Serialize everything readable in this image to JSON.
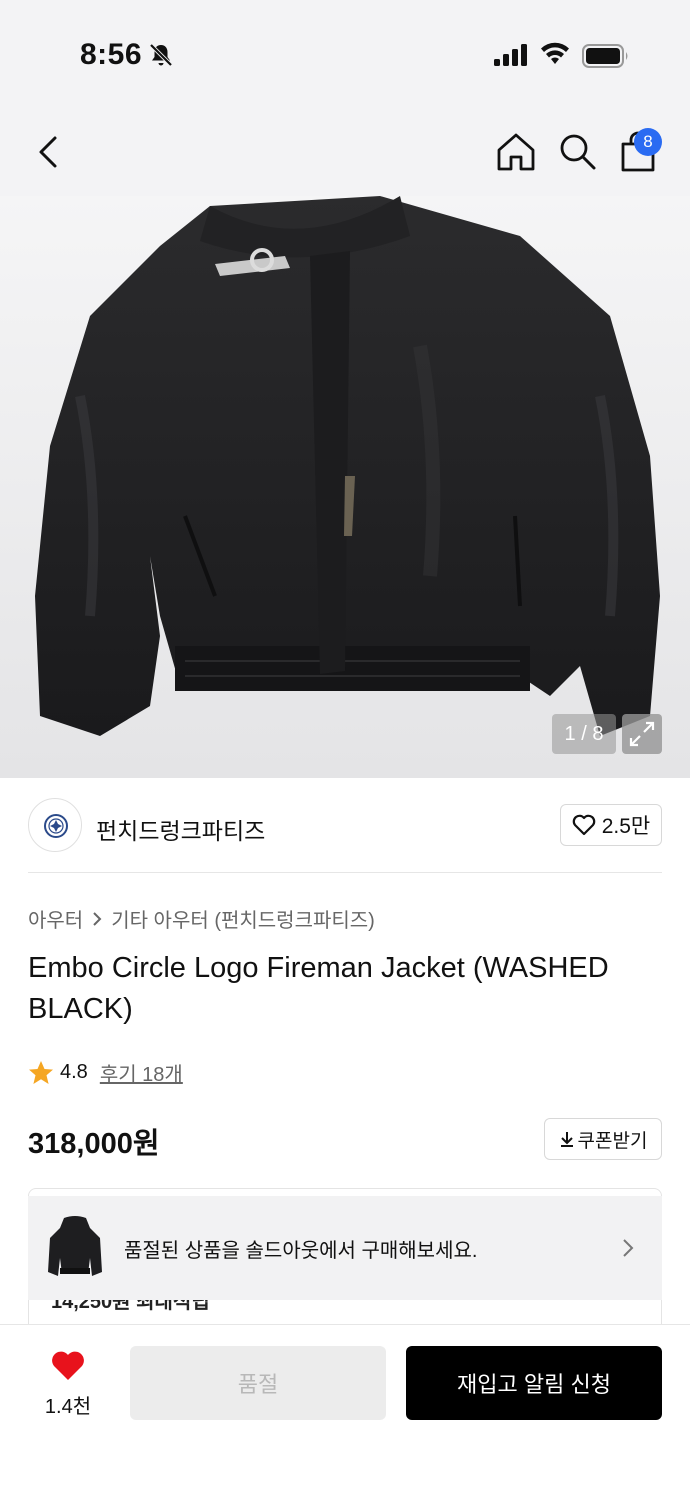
{
  "status_bar": {
    "time": "8:56",
    "icons": [
      "bell-off-icon",
      "signal-icon",
      "wifi-icon",
      "battery-icon"
    ]
  },
  "nav": {
    "icons": [
      "back-icon",
      "home-icon",
      "search-icon",
      "cart-icon"
    ],
    "cart_badge": "8",
    "badge_color": "#2a6bf2"
  },
  "gallery": {
    "counter": "1 / 8",
    "expand_icon": "expand-icon"
  },
  "brand": {
    "name": "펀치드렁크파티즈",
    "like_count": "2.5만"
  },
  "breadcrumb": {
    "category": "아우터",
    "subcategory": "기타 아우터 (펀치드렁크파티즈)"
  },
  "product": {
    "title": "Embo Circle Logo Fireman Jacket (WASHED BLACK)",
    "rating": "4.8",
    "review_link": "후기 18개",
    "price": "318,000원",
    "coupon_label": "쿠폰받기"
  },
  "benefit": {
    "partial_text": "14,250원 최대적립"
  },
  "soldout_banner": {
    "text": "품절된 상품을 솔드아웃에서 구매해보세요."
  },
  "bottom_bar": {
    "wish_count": "1.4천",
    "soldout_label": "품절",
    "restock_label": "재입고 알림 신청",
    "heart_color": "#e8121c"
  }
}
